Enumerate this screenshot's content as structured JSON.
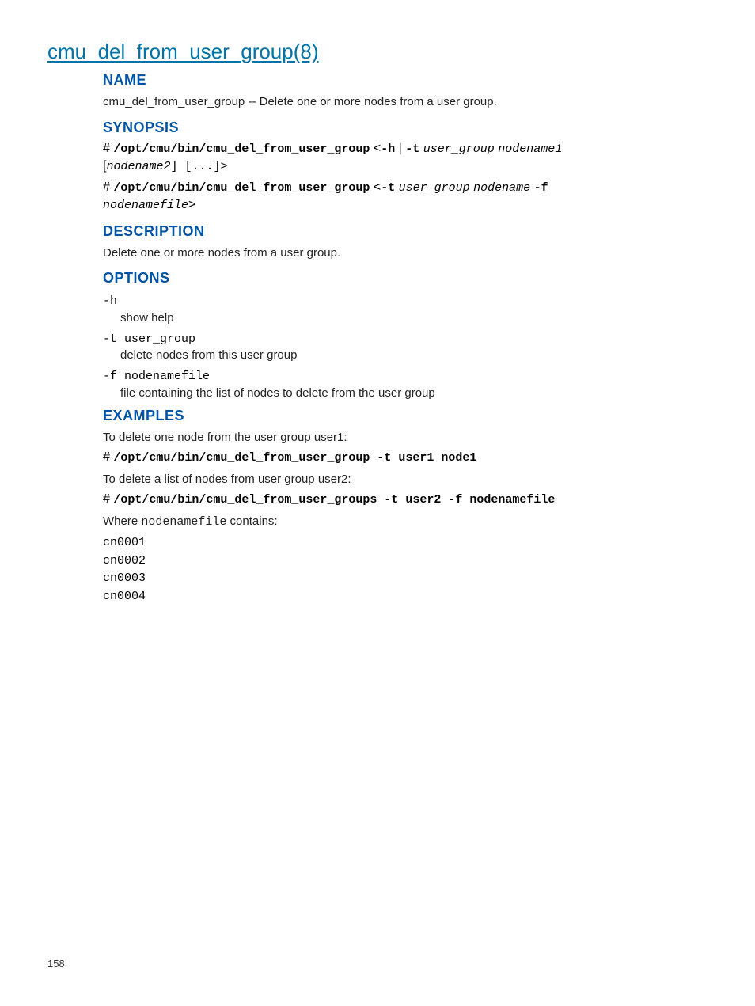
{
  "page_title": "cmu_del_from_user_group(8)",
  "name": {
    "heading": "NAME",
    "cmd": "cmu_del_from_user_group",
    "sep": " -- ",
    "desc": "Delete one or more nodes from a user group."
  },
  "synopsis": {
    "heading": "SYNOPSIS",
    "line1": {
      "prefix": "# ",
      "bold1": "/opt/cmu/bin/cmu_del_from_user_group",
      "mid1": " <",
      "bold2": "-h",
      "mid2": " | ",
      "bold3": "-t",
      "mid3": " ",
      "ital1": "user_group",
      "mid4": " ",
      "ital2": "nodename1",
      "nl_open": "[",
      "ital3": "nodename2",
      "nl_close": "] [...]>"
    },
    "line2": {
      "prefix": "# ",
      "bold1": "/opt/cmu/bin/cmu_del_from_user_group",
      "mid1": " <",
      "bold2": "-t",
      "mid2": " ",
      "ital1": "user_group",
      "mid3": " ",
      "ital2": "nodename",
      "mid4": " ",
      "bold3": "-f",
      "nl_ital": "nodenamefile",
      "nl_close": ">"
    }
  },
  "description": {
    "heading": "DESCRIPTION",
    "text": "Delete one or more nodes from a user group."
  },
  "options": {
    "heading": "OPTIONS",
    "items": [
      {
        "flag": "-h",
        "arg": "",
        "desc": "show help"
      },
      {
        "flag": "-t ",
        "arg": "user_group",
        "desc": "delete nodes from this user group"
      },
      {
        "flag": "-f ",
        "arg": "nodenamefile",
        "desc": "file containing the list of nodes to delete from the user group"
      }
    ]
  },
  "examples": {
    "heading": "EXAMPLES",
    "intro1": "To delete one node from the user group user1:",
    "cmd1_prefix": "# ",
    "cmd1": "/opt/cmu/bin/cmu_del_from_user_group -t user1 node1",
    "intro2": "To delete a list of nodes from user group user2:",
    "cmd2_prefix": "# ",
    "cmd2": "/opt/cmu/bin/cmu_del_from_user_groups -t user2 -f nodenamefile",
    "where_pre": "Where ",
    "where_code": "nodenamefile",
    "where_post": " contains:",
    "file_contents": "cn0001\ncn0002\ncn0003\ncn0004"
  },
  "page_number": "158"
}
